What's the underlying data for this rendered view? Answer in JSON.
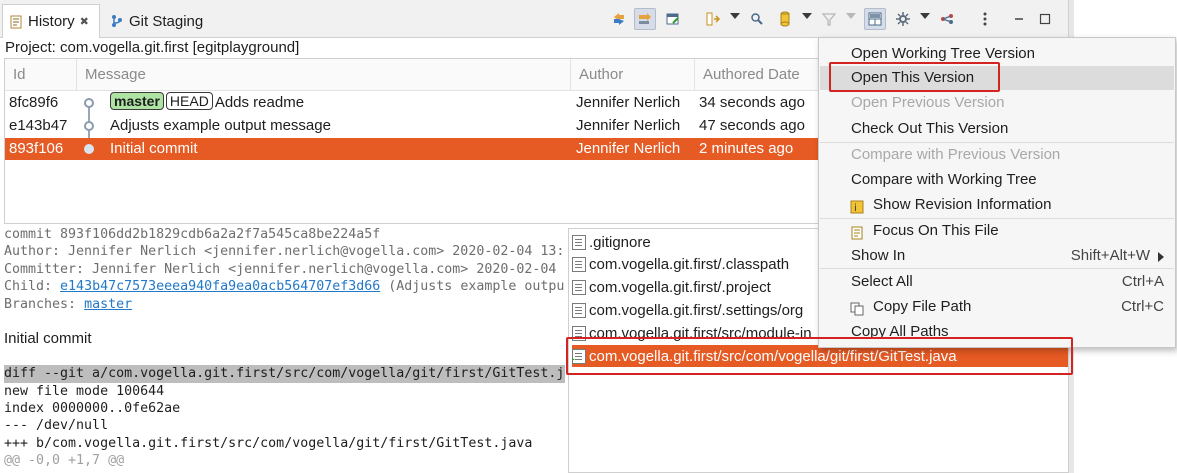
{
  "tabs": [
    {
      "label": "History",
      "icon": "history-icon",
      "active": true
    },
    {
      "label": "Git Staging",
      "icon": "git-staging-icon",
      "active": false
    }
  ],
  "toolbar_icons": [
    "link-with-selection-icon",
    "link-with-editor-icon",
    "pin-icon",
    "compare-mode-icon",
    "search-icon",
    "filter-icon",
    "show-all-branches-icon",
    "layout-icon",
    "settings-icon",
    "view-menu-icon",
    "minimize-icon",
    "maximize-icon"
  ],
  "project_line": "Project: com.vogella.git.first [egitplayground]",
  "history": {
    "columns": [
      "Id",
      "Message",
      "Author",
      "Authored Date"
    ],
    "rows": [
      {
        "id": "8fc89f6",
        "badges": [
          "master",
          "HEAD"
        ],
        "message": "Adds readme",
        "author": "Jennifer Nerlich",
        "date": "34 seconds ago",
        "selected": false
      },
      {
        "id": "e143b47",
        "badges": [],
        "message": "Adjusts example output message",
        "author": "Jennifer Nerlich",
        "date": "47 seconds ago",
        "selected": false
      },
      {
        "id": "893f106",
        "badges": [],
        "message": "Initial commit",
        "author": "Jennifer Nerlich",
        "date": "2 minutes ago",
        "selected": true
      }
    ]
  },
  "details": {
    "commit": "commit 893f106dd2b1829cdb6a2a2f7a545ca8be224a5f",
    "author": "Author: Jennifer Nerlich <jennifer.nerlich@vogella.com> 2020-02-04 13:",
    "committer": "Committer: Jennifer Nerlich <jennifer.nerlich@vogella.com> 2020-02-04",
    "child_prefix": "Child: ",
    "child_link": "e143b47c7573eeea940fa9ea0acb564707ef3d66",
    "child_suffix": " (Adjusts example outpu",
    "branches_prefix": "Branches: ",
    "branches_link": "master",
    "message": "Initial commit",
    "diff_lines": [
      "diff --git a/com.vogella.git.first/src/com/vogella/git/first/GitTest.j",
      "new file mode 100644",
      "index 0000000..0fe62ae",
      "--- /dev/null",
      "+++ b/com.vogella.git.first/src/com/vogella/git/first/GitTest.java",
      "@@ -0,0 +1,7 @@"
    ]
  },
  "files": [
    ".gitignore",
    "com.vogella.git.first/.classpath",
    "com.vogella.git.first/.project",
    "com.vogella.git.first/.settings/org",
    "com.vogella.git.first/src/module-in",
    "com.vogella.git.first/src/com/vogella/git/first/GitTest.java"
  ],
  "context_menu": {
    "items": [
      {
        "label": "Open Working Tree Version",
        "shortcut": "",
        "enabled": true
      },
      {
        "label": "Open This Version",
        "shortcut": "",
        "enabled": true,
        "highlighted": true
      },
      {
        "label": "Open Previous Version",
        "shortcut": "",
        "enabled": false
      },
      {
        "label": "Check Out This Version",
        "shortcut": "",
        "enabled": true
      },
      {
        "label": "Compare with Previous Version",
        "shortcut": "",
        "enabled": false
      },
      {
        "label": "Compare with Working Tree",
        "shortcut": "",
        "enabled": true
      },
      {
        "label": "Show Revision Information",
        "shortcut": "",
        "enabled": true,
        "icon": "revision-info-icon"
      },
      {
        "label": "Focus On This File",
        "shortcut": "",
        "enabled": true,
        "icon": "focus-file-icon"
      },
      {
        "label": "Show In",
        "shortcut": "Shift+Alt+W",
        "enabled": true,
        "submenu": true
      },
      {
        "label": "Select All",
        "shortcut": "Ctrl+A",
        "enabled": true
      },
      {
        "label": "Copy File Path",
        "shortcut": "Ctrl+C",
        "enabled": true,
        "icon": "copy-icon"
      },
      {
        "label": "Copy All Paths",
        "shortcut": "",
        "enabled": true
      }
    ]
  },
  "colors": {
    "selection": "#e65a24",
    "highlight_box": "#d42323",
    "master_badge": "#aee3a4",
    "link": "#2278c9"
  }
}
